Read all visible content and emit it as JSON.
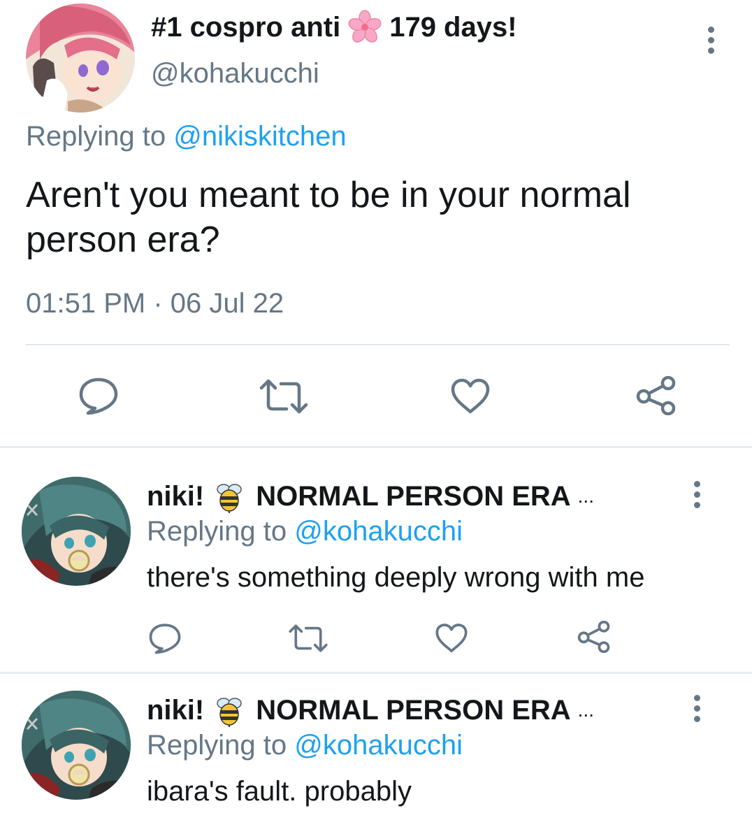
{
  "main_tweet": {
    "display_name_pre": "#1 cospro anti",
    "display_name_emoji": "cherry-blossom-emoji",
    "display_name_post": "179 days!",
    "handle": "@kohakucchi",
    "replying_label": "Replying to",
    "replying_handle": "@nikiskitchen",
    "text": "Aren't you meant to be in your normal person era?",
    "timestamp": "01:51 PM · 06 Jul 22",
    "actions": [
      "reply-icon",
      "retweet-icon",
      "like-icon",
      "share-icon"
    ]
  },
  "replies": [
    {
      "display_name_pre": "niki!",
      "display_name_emoji": "bee-emoji",
      "display_name_post": "NORMAL PERSON ERA",
      "truncation": "...",
      "replying_label": "Replying to",
      "replying_handle": "@kohakucchi",
      "text": "there's something deeply wrong with me"
    },
    {
      "display_name_pre": "niki!",
      "display_name_emoji": "bee-emoji",
      "display_name_post": "NORMAL PERSON ERA",
      "truncation": "...",
      "replying_label": "Replying to",
      "replying_handle": "@kohakucchi",
      "text": "ibara's fault. probably"
    }
  ],
  "colors": {
    "text": "#14171a",
    "muted": "#657786",
    "link": "#1da1f2",
    "divider": "#e1e8ed"
  }
}
